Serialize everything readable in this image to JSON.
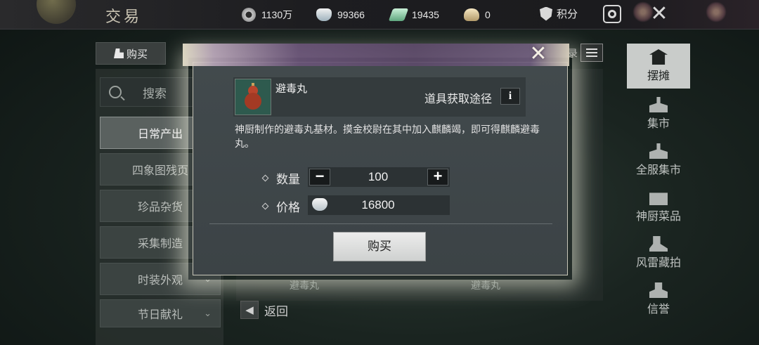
{
  "header": {
    "title": "交易",
    "currencies": [
      {
        "icon": "coin-icon",
        "value": "1130万"
      },
      {
        "icon": "silver-ingot-icon",
        "value": "99366"
      },
      {
        "icon": "jade-icon",
        "value": "19435"
      },
      {
        "icon": "gold-ingot-icon",
        "value": "0"
      }
    ],
    "points_label": "积分"
  },
  "tabs": {
    "buy": "购买"
  },
  "record_partial": "录",
  "search": {
    "label": "搜索"
  },
  "categories": [
    {
      "label": "日常产出",
      "active": true
    },
    {
      "label": "四象图残页"
    },
    {
      "label": "珍品杂货"
    },
    {
      "label": "采集制造"
    },
    {
      "label": "时装外观"
    },
    {
      "label": "节日献礼"
    }
  ],
  "ghost_items": [
    "避毒丸",
    "避毒丸"
  ],
  "return_label": "返回",
  "right_nav": [
    {
      "label": "摆摊",
      "active": true
    },
    {
      "label": "集市"
    },
    {
      "label": "全服集市"
    },
    {
      "label": "神厨菜品"
    },
    {
      "label": "风雷藏拍"
    },
    {
      "label": "信誉"
    }
  ],
  "modal": {
    "item_name": "避毒丸",
    "source_label": "道具获取途径",
    "info_glyph": "i",
    "description": "神厨制作的避毒丸基材。摸金校尉在其中加入麒麟竭，即可得麒麟避毒丸。",
    "quantity_label": "数量",
    "quantity": "100",
    "minus": "−",
    "plus": "+",
    "price_label": "价格",
    "price": "16800",
    "buy_button": "购买",
    "close_glyph": "✕"
  },
  "colors": {
    "accent_banner": "#5d4a6a",
    "button_bg": "#ececec",
    "active_nav": "#c9ccca"
  }
}
